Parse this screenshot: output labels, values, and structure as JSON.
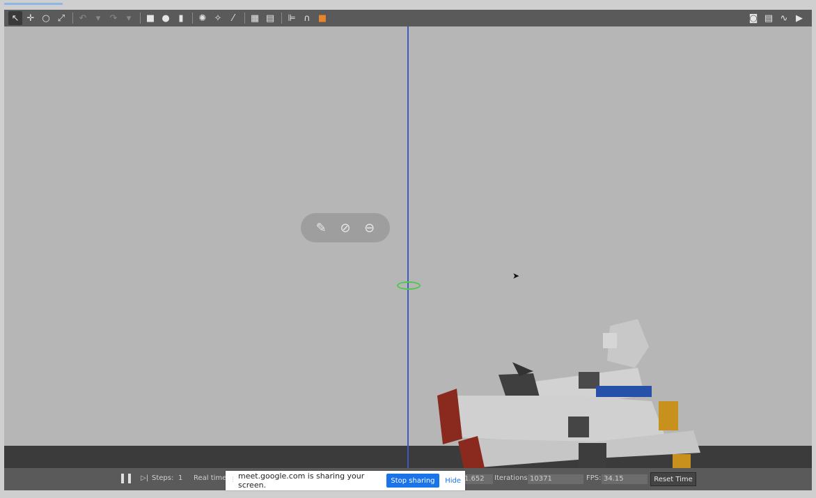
{
  "toolbar": {
    "left_tools": [
      {
        "name": "select-tool-icon",
        "glyph": "↖",
        "active": true
      },
      {
        "name": "translate-tool-icon",
        "glyph": "✛"
      },
      {
        "name": "rotate-tool-icon",
        "glyph": "○"
      },
      {
        "name": "scale-tool-icon",
        "glyph": "⤢"
      },
      {
        "sep": true
      },
      {
        "name": "undo-icon",
        "glyph": "↶",
        "dim": true
      },
      {
        "name": "undo-history-icon",
        "glyph": "▾",
        "dim": true
      },
      {
        "name": "redo-icon",
        "glyph": "↷",
        "dim": true
      },
      {
        "name": "redo-history-icon",
        "glyph": "▾",
        "dim": true
      },
      {
        "sep": true
      },
      {
        "name": "box-shape-icon",
        "glyph": "■"
      },
      {
        "name": "sphere-shape-icon",
        "glyph": "●"
      },
      {
        "name": "cylinder-shape-icon",
        "glyph": "▮"
      },
      {
        "sep": true
      },
      {
        "name": "point-light-icon",
        "glyph": "✺"
      },
      {
        "name": "spot-light-icon",
        "glyph": "✧"
      },
      {
        "name": "directional-light-icon",
        "glyph": "⁄"
      },
      {
        "sep": true
      },
      {
        "name": "copy-icon",
        "glyph": "▦"
      },
      {
        "name": "paste-icon",
        "glyph": "▤"
      },
      {
        "sep": true
      },
      {
        "name": "align-icon",
        "glyph": "⊫"
      },
      {
        "name": "snap-icon",
        "glyph": "∩"
      },
      {
        "name": "orange-model-icon",
        "glyph": "■",
        "color": "#e8842a"
      }
    ],
    "right_tools": [
      {
        "name": "screenshot-icon",
        "glyph": "◙"
      },
      {
        "name": "log-icon",
        "glyph": "▤"
      },
      {
        "name": "plot-icon",
        "glyph": "∿"
      },
      {
        "name": "record-video-icon",
        "glyph": "▶"
      }
    ]
  },
  "viewport": {
    "floating_toolbar": [
      {
        "name": "pin-icon",
        "glyph": "✎"
      },
      {
        "name": "disable-audio-icon",
        "glyph": "⊘"
      },
      {
        "name": "collapse-icon",
        "glyph": "⊖"
      }
    ],
    "colors": {
      "background": "#b6b6b6",
      "ground": "#3b3b3b",
      "axis": "#3b5bbd",
      "origin_marker": "#4cc94c",
      "robot_white": "#d2d2d2",
      "robot_dark": "#4a4a4a",
      "robot_red": "#8a2a1e",
      "robot_orange": "#c8901c",
      "robot_blue": "#2552a8"
    }
  },
  "bottom_bar": {
    "steps_label": "Steps:",
    "steps_value": "1",
    "real_time_label": "Real time",
    "sim_time_value": "1.652",
    "iterations_label": "Iterations:",
    "iterations_value": "10371",
    "fps_label": "FPS:",
    "fps_value": "34.15",
    "reset_time_label": "Reset Time"
  },
  "share_banner": {
    "message": "meet.google.com is sharing your screen.",
    "stop_label": "Stop sharing",
    "hide_label": "Hide"
  }
}
